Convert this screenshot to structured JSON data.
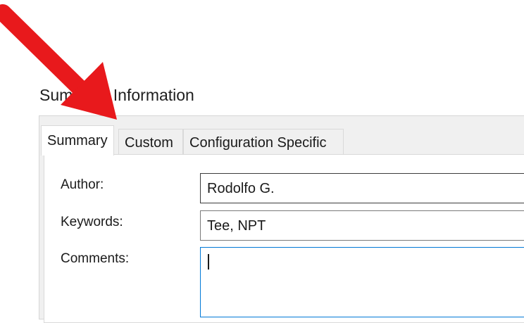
{
  "dialog": {
    "title": "Summary Information"
  },
  "tabs": [
    {
      "label": "Summary",
      "active": true
    },
    {
      "label": "Custom",
      "active": false
    },
    {
      "label": "Configuration Specific",
      "active": false
    }
  ],
  "fields": {
    "author": {
      "label": "Author:",
      "value": "Rodolfo G."
    },
    "keywords": {
      "label": "Keywords:",
      "value": "Tee, NPT"
    },
    "comments": {
      "label": "Comments:",
      "value": ""
    }
  },
  "annotation": {
    "icon": "red-arrow-icon",
    "color": "#e8191c"
  },
  "colors": {
    "focus_border": "#0078d7",
    "tab_strip_bg": "#f0f0f0"
  }
}
